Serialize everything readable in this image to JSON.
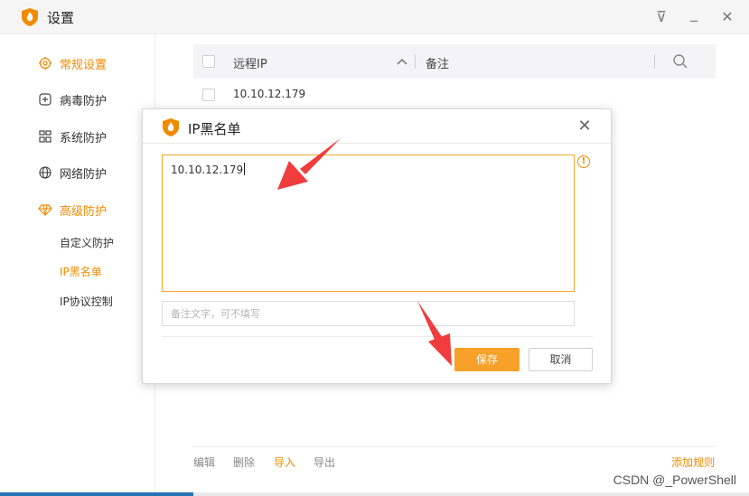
{
  "app": {
    "title": "设置",
    "logo_icon": "shield-flame-logo"
  },
  "window_controls": [
    {
      "name": "menu-dropdown-icon",
      "glyph": "⊽"
    },
    {
      "name": "minimize-icon",
      "glyph": "_"
    },
    {
      "name": "close-icon",
      "glyph": "✕"
    }
  ],
  "sidebar": {
    "items": [
      {
        "label": "常规设置",
        "icon": "gear-icon",
        "active": true
      },
      {
        "label": "病毒防护",
        "icon": "plus-square-icon",
        "active": false
      },
      {
        "label": "系统防护",
        "icon": "grid-icon",
        "active": false
      },
      {
        "label": "网络防护",
        "icon": "globe-icon",
        "active": false
      },
      {
        "label": "高级防护",
        "icon": "diamond-icon",
        "active": true
      }
    ],
    "subitems": [
      {
        "label": "自定义防护",
        "active": false
      },
      {
        "label": "IP黑名单",
        "active": true
      },
      {
        "label": "IP协议控制",
        "active": false
      }
    ]
  },
  "table": {
    "columns": {
      "remote_ip": "远程IP",
      "note": "备注"
    },
    "sort_icon": "chevron-up-icon",
    "search_icon": "search-icon",
    "rows": [
      {
        "ip": "10.10.12.179",
        "note": ""
      }
    ]
  },
  "footer": {
    "edit": "编辑",
    "delete": "删除",
    "import": "导入",
    "export": "导出",
    "add_rule": "添加规则"
  },
  "dialog": {
    "title": "IP黑名单",
    "ip_value": "10.10.12.179",
    "note_placeholder": "备注文字，可不填写",
    "save_label": "保存",
    "cancel_label": "取消",
    "warning_icon": "exclamation-circle-icon"
  },
  "watermark": "CSDN @_PowerShell",
  "colors": {
    "accent": "#f08a00",
    "save_button": "#f7a02a",
    "arrow": "#f03c3c",
    "focus_border": "#f5a623"
  }
}
